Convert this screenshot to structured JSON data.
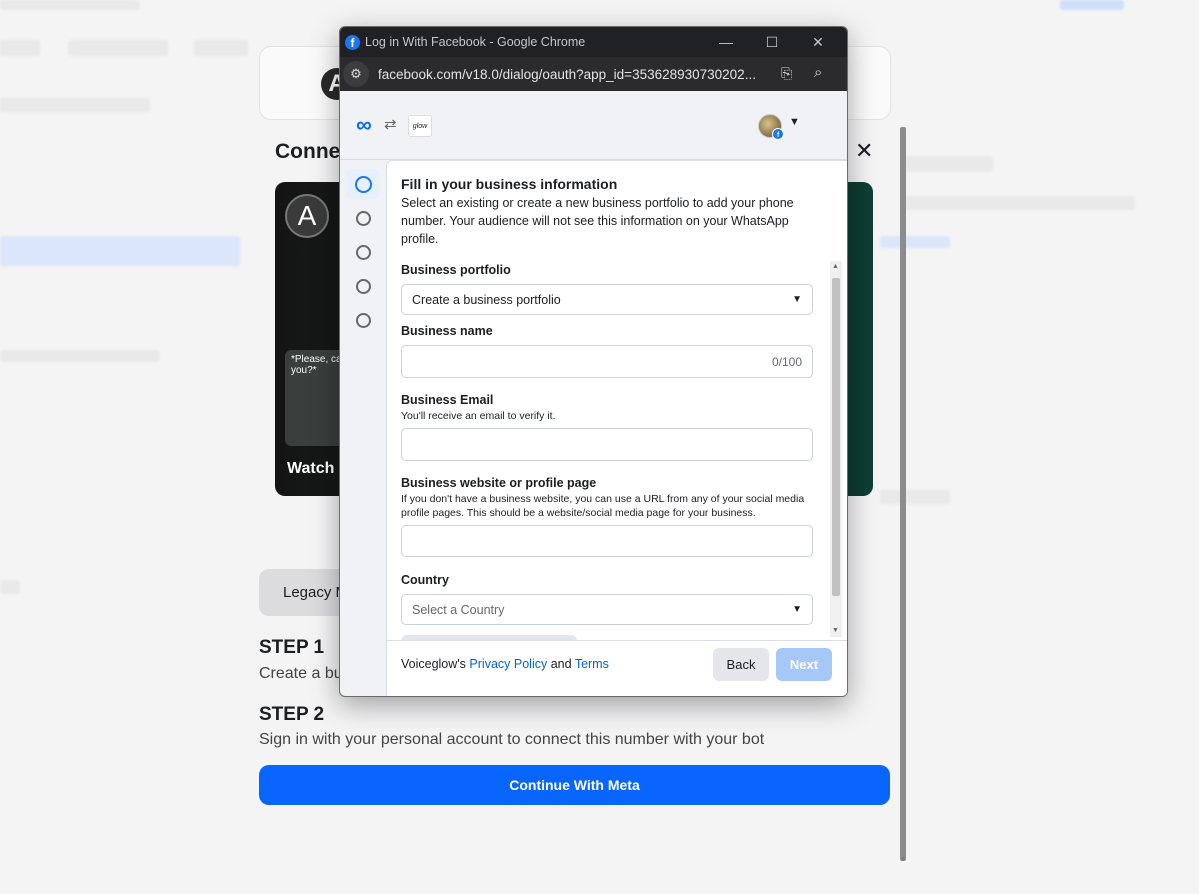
{
  "background": {
    "section_title": "Conne",
    "video_caption": "Watch",
    "video_bubble": "*Please, ca you?*",
    "legacy_button": "Legacy M",
    "step1_title": "STEP 1",
    "step1_text": "Create a bu",
    "step2_title": "STEP 2",
    "step2_text": "Sign in with your personal account to connect this number with your bot",
    "cta_label": "Continue With Meta",
    "close_glyph": "✕",
    "logo_letter": "A"
  },
  "window": {
    "title": "Log in With Facebook - Google Chrome",
    "url": "facebook.com/v18.0/dialog/oauth?app_id=353628930730202..."
  },
  "brand": {
    "partner_logo_text": "glow",
    "accent_color": "#0866ff",
    "link_color": "#0064d1"
  },
  "steps": {
    "count": 5,
    "active_index": 0
  },
  "form": {
    "title": "Fill in your business information",
    "description": "Select an existing or create a new business portfolio to add your phone number. Your audience will not see this information on your WhatsApp profile.",
    "portfolio": {
      "label": "Business portfolio",
      "selected": "Create a business portfolio"
    },
    "name": {
      "label": "Business name",
      "value": "",
      "counter": "0/100"
    },
    "email": {
      "label": "Business Email",
      "help": "You'll receive an email to verify it.",
      "value": ""
    },
    "website": {
      "label": "Business website or profile page",
      "help": "If you don't have a business website, you can use a URL from any of your social media profile pages. This should be a website/social media page for your business.",
      "value": ""
    },
    "country": {
      "label": "Country",
      "placeholder": "Select a Country"
    }
  },
  "footer": {
    "brand_prefix": "Voiceglow's",
    "privacy_link": "Privacy Policy",
    "conjunction": "and",
    "terms_link": "Terms",
    "back_label": "Back",
    "next_label": "Next"
  }
}
